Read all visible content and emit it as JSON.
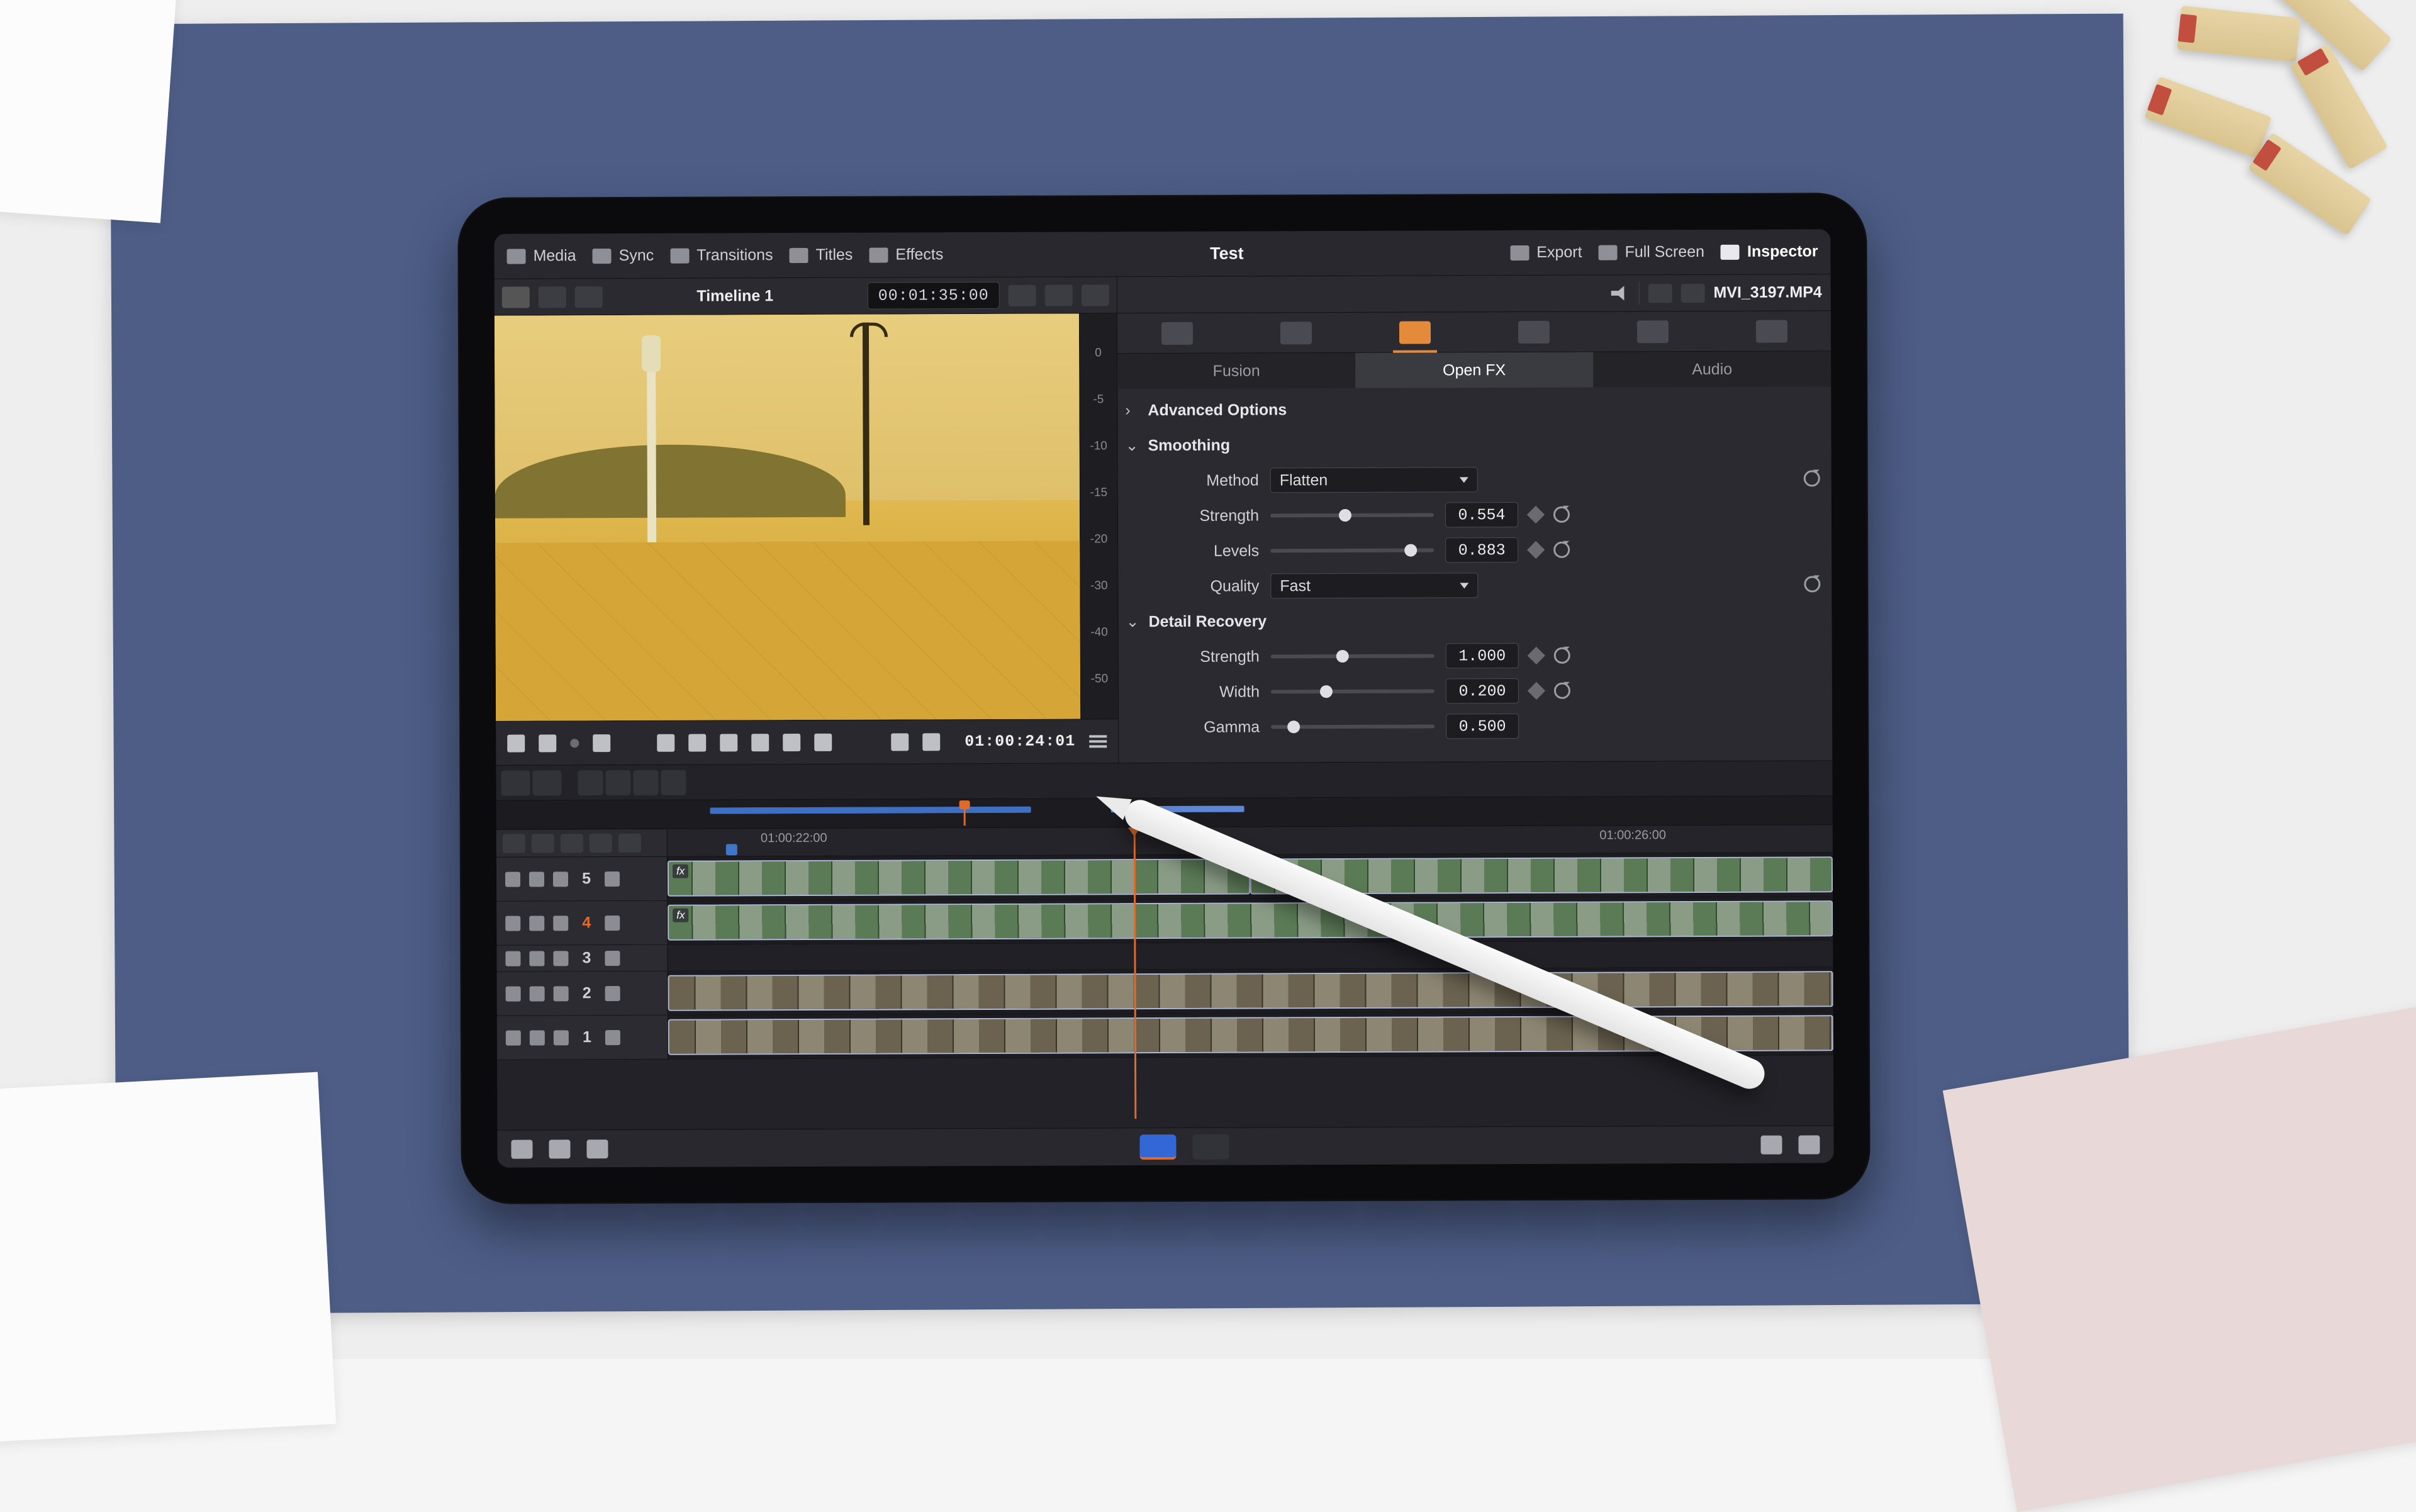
{
  "project_name": "Test",
  "topbar": {
    "media": "Media",
    "sync": "Sync",
    "transitions": "Transitions",
    "titles": "Titles",
    "effects": "Effects",
    "export": "Export",
    "full_screen": "Full Screen",
    "inspector": "Inspector"
  },
  "viewer": {
    "timeline_name": "Timeline 1",
    "duration_tc": "00:01:35:00",
    "playhead_tc": "01:00:24:01"
  },
  "vu_labels": [
    "0",
    "-5",
    "-10",
    "-15",
    "-20",
    "-30",
    "-40",
    "-50"
  ],
  "clip": {
    "file_name": "MVI_3197.MP4"
  },
  "inspector": {
    "tabs": [
      "video",
      "audio",
      "effects",
      "transition",
      "image",
      "file"
    ],
    "active_tab": "effects",
    "subtabs": {
      "fusion": "Fusion",
      "openfx": "Open FX",
      "audio": "Audio"
    },
    "active_subtab": "openfx",
    "sections": {
      "advanced": "Advanced Options",
      "smoothing": "Smoothing",
      "detail": "Detail Recovery"
    },
    "smoothing": {
      "method_label": "Method",
      "method_value": "Flatten",
      "strength_label": "Strength",
      "strength_value": "0.554",
      "strength_pos": 0.42,
      "levels_label": "Levels",
      "levels_value": "0.883",
      "levels_pos": 0.82,
      "quality_label": "Quality",
      "quality_value": "Fast"
    },
    "detail": {
      "strength_label": "Strength",
      "strength_value": "1.000",
      "strength_pos": 0.4,
      "width_label": "Width",
      "width_value": "0.200",
      "width_pos": 0.3,
      "gamma_label": "Gamma",
      "gamma_value": "0.500",
      "gamma_pos": 0.1
    }
  },
  "timeline": {
    "ruler_labels": [
      {
        "tc": "01:00:22:00",
        "pos_pct": 8
      },
      {
        "tc": "01:00:26:00",
        "pos_pct": 80
      }
    ],
    "playhead_pct": 40,
    "minimap": {
      "segments": [
        {
          "left_pct": 16,
          "width_pct": 16,
          "cls": ""
        },
        {
          "left_pct": 16,
          "width_pct": 24,
          "cls": "a"
        },
        {
          "left_pct": 46,
          "width_pct": 10,
          "cls": ""
        }
      ],
      "playhead_pct": 35
    },
    "tracks": [
      {
        "num": "5",
        "selected": false,
        "clips": [
          {
            "left_pct": 0,
            "width_pct": 50,
            "fx": true,
            "variant": 1
          },
          {
            "left_pct": 50,
            "width_pct": 50,
            "fx": true,
            "variant": 1
          }
        ]
      },
      {
        "num": "4",
        "selected": true,
        "clips": [
          {
            "left_pct": 0,
            "width_pct": 100,
            "fx": true,
            "variant": 1
          }
        ]
      },
      {
        "num": "3",
        "selected": false,
        "thin": true,
        "clips": []
      },
      {
        "num": "2",
        "selected": false,
        "clips": [
          {
            "left_pct": 0,
            "width_pct": 100,
            "fx": false,
            "variant": 2
          }
        ]
      },
      {
        "num": "1",
        "selected": false,
        "clips": [
          {
            "left_pct": 0,
            "width_pct": 100,
            "fx": false,
            "variant": 2
          }
        ]
      }
    ]
  },
  "fx_badge": "fx"
}
